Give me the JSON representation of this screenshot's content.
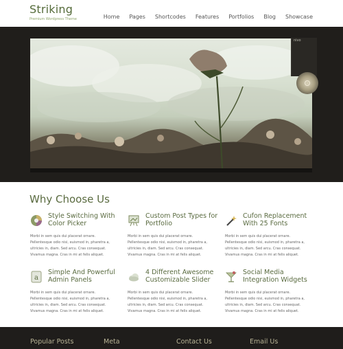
{
  "site": {
    "title": "Striking",
    "subtitle": "Premium Wordpress Theme"
  },
  "nav": [
    "Home",
    "Pages",
    "Shortcodes",
    "Features",
    "Portfolios",
    "Blog",
    "Showcase"
  ],
  "slider": {
    "thumb_label": "nivo"
  },
  "why": {
    "title": "Why Choose Us",
    "items": [
      {
        "icon": "color-wheel-icon",
        "title": "Style Switching With Color Picker",
        "text": "Morbi in sem quis dui placerat ornare. Pellentesque odio nisi, euismod in, pharetra a, ultricies in, diam. Sed arcu. Cras consequat. Vivamus magna. Cras in mi at felis aliquet."
      },
      {
        "icon": "easel-icon",
        "title": "Custom Post Types for Portfolio",
        "text": "Morbi in sem quis dui placerat ornare. Pellentesque odio nisi, euismod in, pharetra a, ultricies in, diam. Sed arcu. Cras consequat. Vivamus magna. Cras in mi at felis aliquet."
      },
      {
        "icon": "magic-wand-icon",
        "title": "Cufon Replacement With 25 Fonts",
        "text": "Morbi in sem quis dui placerat ornare. Pellentesque odio nisi, euismod in, pharetra a, ultricies in, diam. Sed arcu. Cras consequat. Vivamus magna. Cras in mi at felis aliquet."
      },
      {
        "icon": "font-letter-icon",
        "title": "Simple And Powerful Admin Panels",
        "text": "Morbi in sem quis dui placerat ornare. Pellentesque odio nisi, euismod in, pharetra a, ultricies in, diam. Sed arcu. Cras consequat. Vivamus magna. Cras in mi at felis aliquet."
      },
      {
        "icon": "cloud-icon",
        "title": "4 Different Awesome Customizable Slider",
        "text": "Morbi in sem quis dui placerat ornare. Pellentesque odio nisi, euismod in, pharetra a, ultricies in, diam. Sed arcu. Cras consequat. Vivamus magna. Cras in mi at felis aliquet."
      },
      {
        "icon": "cocktail-icon",
        "title": "Social Media Integration Widgets",
        "text": "Morbi in sem quis dui placerat ornare. Pellentesque odio nisi, euismod in, pharetra a, ultricies in, diam. Sed arcu. Cras consequat. Vivamus magna. Cras in mi at felis aliquet."
      }
    ]
  },
  "footer": [
    "Popular Posts",
    "Meta",
    "Contact Us",
    "Email Us"
  ],
  "colors": {
    "accent": "#5a6b40",
    "dark_band": "#201e1b",
    "footer_text": "#b9b496"
  }
}
